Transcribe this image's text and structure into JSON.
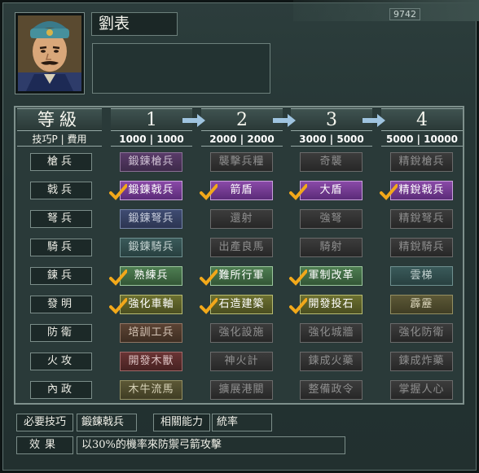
{
  "general": {
    "name": "劉表"
  },
  "background_counter": "9742",
  "header": {
    "level_label": "等級",
    "sub_label": "技巧P | 費用",
    "columns": [
      {
        "level": "1",
        "cost": "1000 | 1000"
      },
      {
        "level": "2",
        "cost": "2000 | 2000"
      },
      {
        "level": "3",
        "cost": "3000 | 5000"
      },
      {
        "level": "4",
        "cost": "5000 | 10000"
      }
    ]
  },
  "rows": [
    {
      "label": "槍兵",
      "skills": [
        "鍛鍊槍兵",
        "襲擊兵糧",
        "奇襲",
        "精銳槍兵"
      ]
    },
    {
      "label": "戟兵",
      "skills": [
        "鍛鍊戟兵",
        "箭盾",
        "大盾",
        "精銳戟兵"
      ]
    },
    {
      "label": "弩兵",
      "skills": [
        "鍛鍊弩兵",
        "還射",
        "強弩",
        "精銳弩兵"
      ]
    },
    {
      "label": "騎兵",
      "skills": [
        "鍛鍊騎兵",
        "出產良馬",
        "騎射",
        "精銳騎兵"
      ]
    },
    {
      "label": "鍊兵",
      "skills": [
        "熟練兵",
        "難所行軍",
        "軍制改革",
        "雲梯"
      ]
    },
    {
      "label": "發明",
      "skills": [
        "強化車軸",
        "石造建築",
        "開發投石",
        "霹靂"
      ]
    },
    {
      "label": "防衛",
      "skills": [
        "培訓工兵",
        "強化設施",
        "強化城牆",
        "強化防衛"
      ]
    },
    {
      "label": "火攻",
      "skills": [
        "開發木獸",
        "神火計",
        "鍊成火藥",
        "鍊成炸藥"
      ]
    },
    {
      "label": "內政",
      "skills": [
        "木牛流馬",
        "擴展港關",
        "整備政令",
        "掌握人心"
      ]
    }
  ],
  "footer": {
    "required_label": "必要技巧",
    "required_value": "鍛鍊戟兵",
    "ability_label": "相關能力",
    "ability_value": "統率",
    "effect_label": "效果",
    "effect_value": "以30%的機率來防禦弓箭攻擊"
  },
  "colors": {
    "purple": "#8a4aa8",
    "green": "#4e7e52",
    "olive": "#6c7030",
    "locked": "#3c3c3c",
    "checkmark": "#f2a81a"
  }
}
